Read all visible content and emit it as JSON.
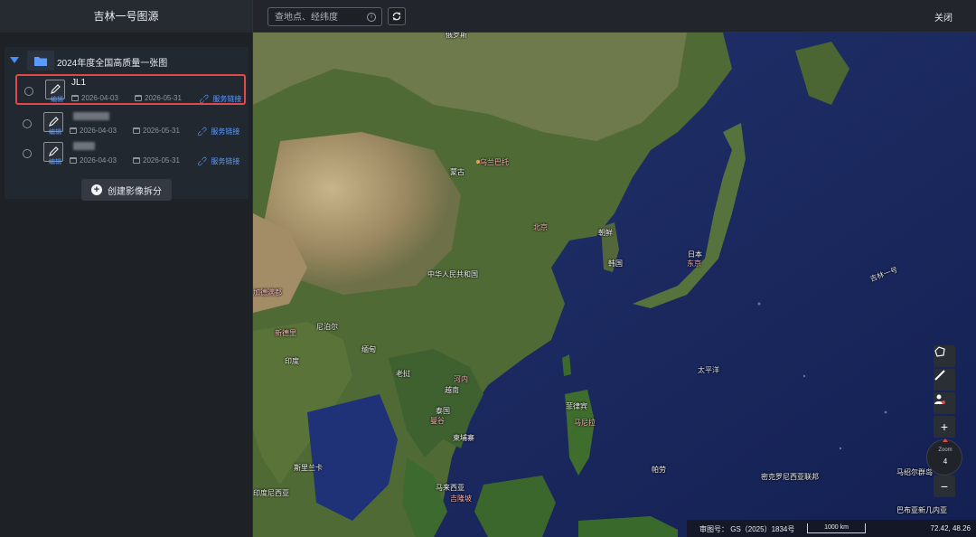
{
  "header": {
    "app_title": "吉林一号图源",
    "search_placeholder": "查地点、经纬度",
    "close_label": "关闭"
  },
  "sidebar": {
    "group_title": "2024年度全国高质量一张图",
    "rows": [
      {
        "name": "JL1",
        "edit": "编辑",
        "start": "2026-04-03",
        "end": "2026-05-31",
        "link": "服务链接",
        "selected": true
      },
      {
        "name": "",
        "edit": "编辑",
        "start": "2026-04-03",
        "end": "2026-05-31",
        "link": "服务链接",
        "selected": false
      },
      {
        "name": "",
        "edit": "编辑",
        "start": "2026-04-03",
        "end": "2026-05-31",
        "link": "服务链接",
        "selected": false
      }
    ],
    "create_button": "创建影像拆分"
  },
  "map": {
    "labels": {
      "beijing": "北京",
      "ulaanbaatar": "乌兰巴托",
      "mongolia": "蒙古",
      "china": "中华人民共和国",
      "pyongyang": "朝鲜",
      "seoul": "韩国",
      "japan": "日本",
      "tokyo": "东京",
      "nepal": "尼泊尔",
      "india": "印度",
      "myanmar": "缅甸",
      "laos": "老挝",
      "thailand": "泰国",
      "cambodia": "柬埔寨",
      "vietnam": "越南",
      "philippines": "菲律宾",
      "manila": "马尼拉",
      "pacific": "太平洋",
      "jilin": "吉林一号",
      "malaysia": "马来西亚",
      "palau": "帕劳",
      "marshall": "马绍尔群岛",
      "micronesia": "密克罗尼西亚联邦",
      "indonesia": "印度尼西亚",
      "srilanka": "斯里兰卡",
      "kathmandu": "加德满都",
      "newdelhi": "新德里",
      "hanoi": "河内",
      "bangkok": "曼谷",
      "kualalumpur": "吉隆坡",
      "pngn": "巴布亚新几内亚",
      "russia": "俄罗斯"
    },
    "zoom_label": "Zoom",
    "zoom_level": "4",
    "approval_number": "审图号： GS（2025）1834号",
    "scale_label": "1000 km",
    "coordinates": "72.42, 48.26",
    "colors": {
      "selection": "#e0484a",
      "accent": "#5b9bff",
      "ocean": "#1b2a5e"
    }
  }
}
